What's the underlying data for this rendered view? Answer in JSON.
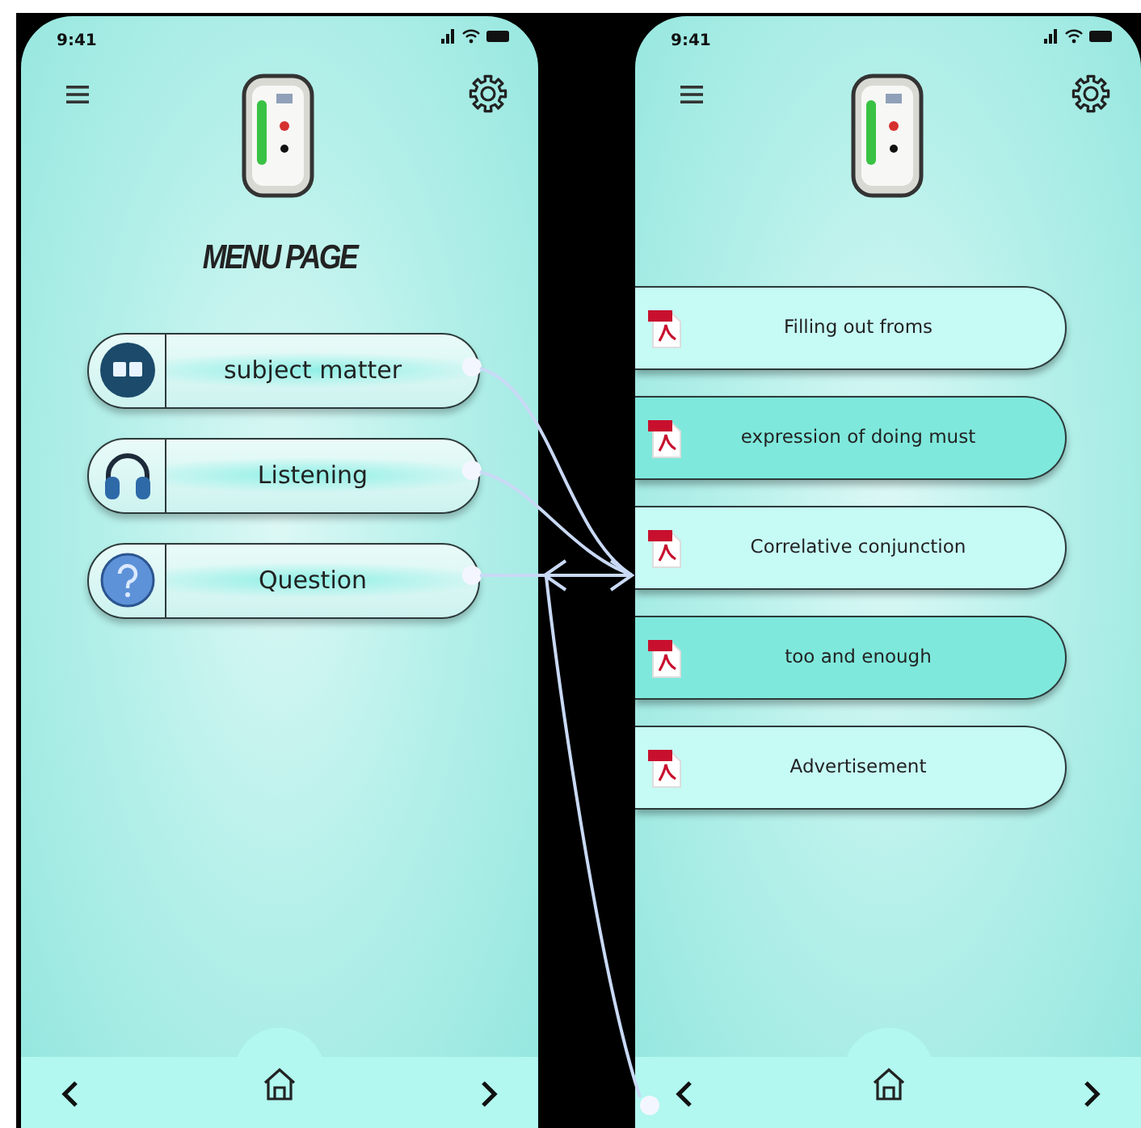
{
  "left_screen": {
    "status_time": "9:41",
    "title": "MENU PAGE",
    "menu_items": [
      {
        "label": "subject matter",
        "kind": "book"
      },
      {
        "label": "Listening",
        "kind": "headphones"
      },
      {
        "label": "Question",
        "kind": "question"
      }
    ]
  },
  "right_screen": {
    "status_time": "9:41",
    "documents": [
      {
        "label": "Filling out froms"
      },
      {
        "label": "expression of doing must"
      },
      {
        "label": "Correlative conjunction"
      },
      {
        "label": "too and enough"
      },
      {
        "label": "Advertisement"
      }
    ]
  }
}
